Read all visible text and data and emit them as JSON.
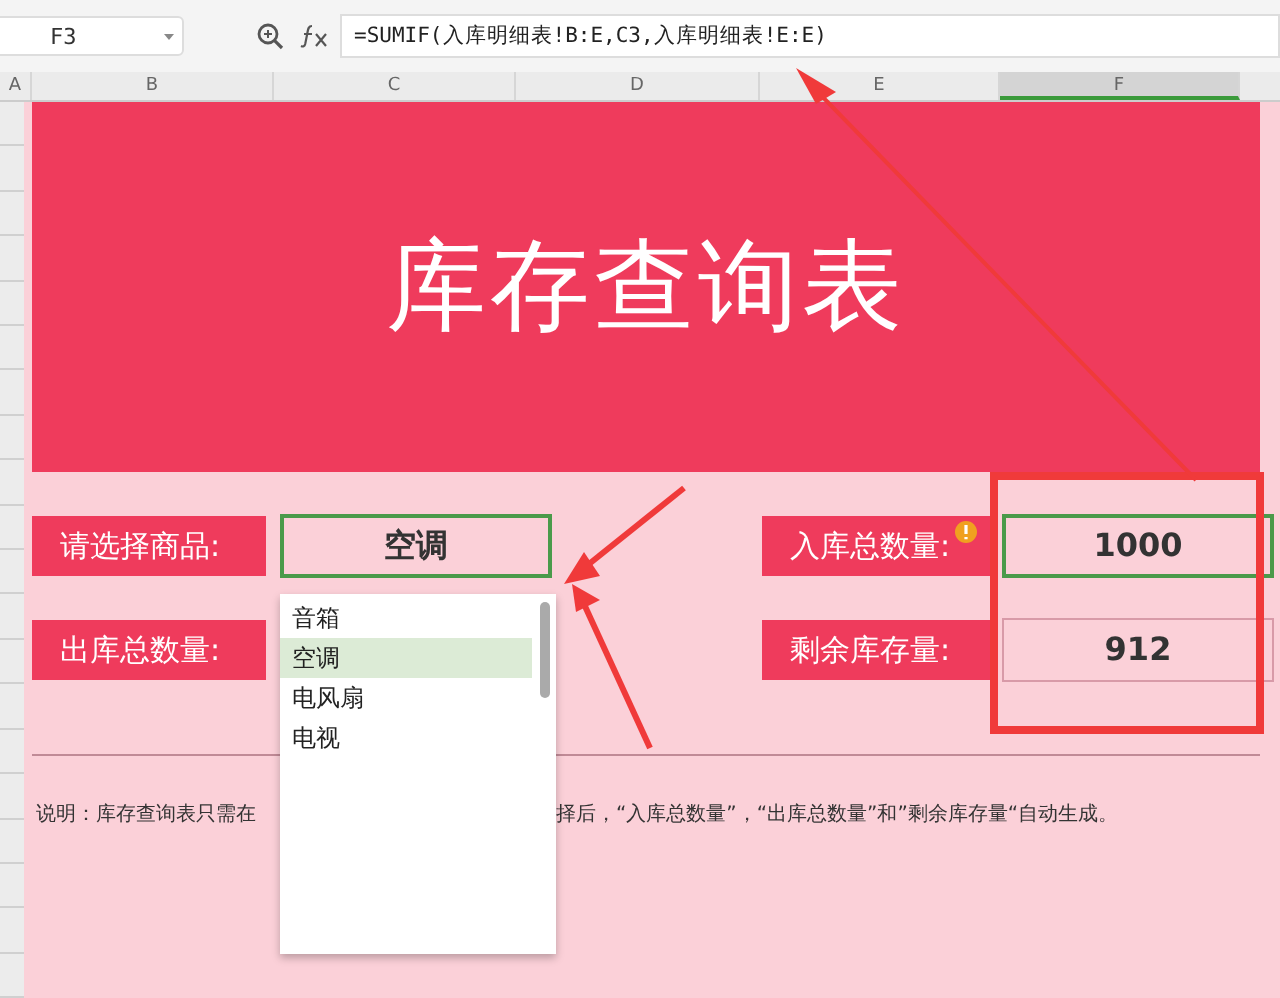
{
  "formula_bar": {
    "cell_ref": "F3",
    "formula": "=SUMIF(入库明细表!B:E,C3,入库明细表!E:E)"
  },
  "columns": [
    {
      "label": "A",
      "selected": false
    },
    {
      "label": "B",
      "selected": false
    },
    {
      "label": "C",
      "selected": false
    },
    {
      "label": "D",
      "selected": false
    },
    {
      "label": "E",
      "selected": false
    },
    {
      "label": "F",
      "selected": true
    }
  ],
  "title": "库存查询表",
  "rows": [
    {
      "left": {
        "label": "请选择商品:",
        "value": "空调",
        "selected": true
      },
      "right": {
        "label": "入库总数量:",
        "value": "1000",
        "selected": true
      }
    },
    {
      "left": {
        "label": "出库总数量:"
      },
      "right": {
        "label": "剩余库存量:",
        "value": "912",
        "selected": false
      }
    }
  ],
  "dropdown": {
    "options": [
      {
        "label": "音箱",
        "selected": false
      },
      {
        "label": "空调",
        "selected": true
      },
      {
        "label": "电风扇",
        "selected": false
      },
      {
        "label": "电视",
        "selected": false
      }
    ]
  },
  "note": [
    "说明：库存查询表只需在",
    "择后，“入库总数量”，“出库总数量”和”剩余库存量“自动生成。"
  ]
}
